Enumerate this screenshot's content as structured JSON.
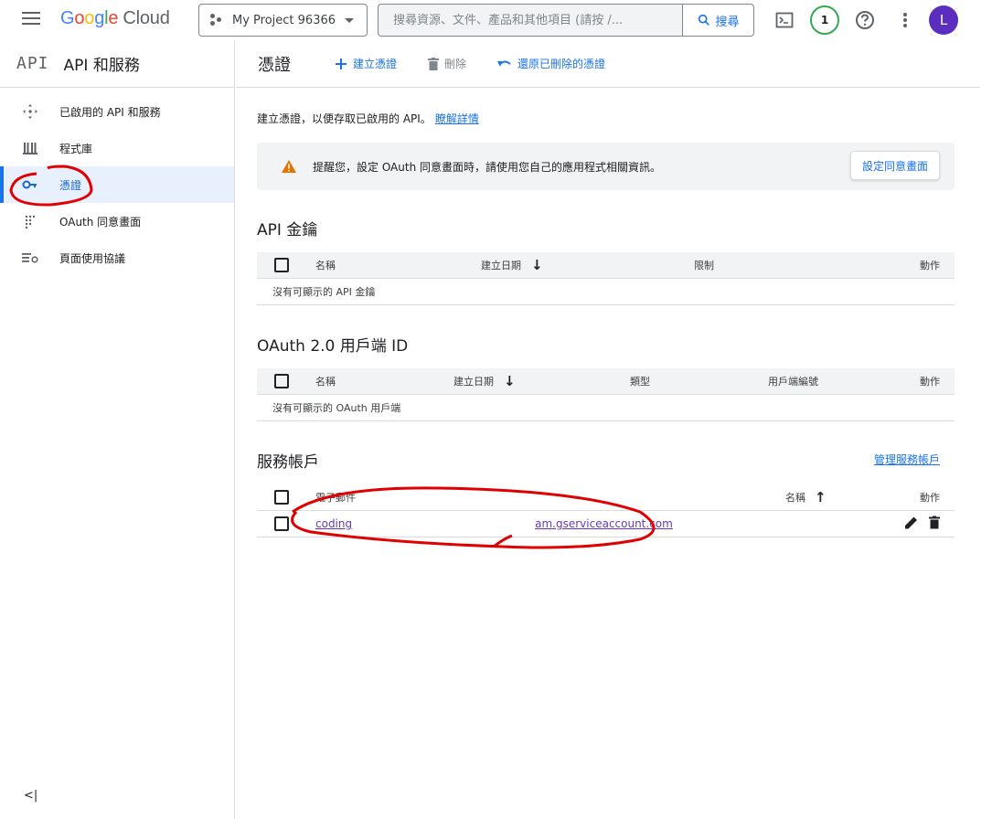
{
  "topbar": {
    "logo": {
      "g": "G",
      "o1": "o",
      "o2": "o",
      "g2": "g",
      "l": "l",
      "e": "e",
      "cloud": "Cloud"
    },
    "project_label": "My Project 96366",
    "search_placeholder": "搜尋資源、文件、產品和其他項目 (請按 /...",
    "search_button": "搜尋",
    "notification_count": "1",
    "avatar_letter": "L"
  },
  "sidebar": {
    "logo_text": "API",
    "title": "API 和服務",
    "items": [
      {
        "label": "已啟用的 API 和服務",
        "icon": "api-diamond-icon"
      },
      {
        "label": "程式庫",
        "icon": "library-icon"
      },
      {
        "label": "憑證",
        "icon": "key-icon",
        "active": true
      },
      {
        "label": "OAuth 同意畫面",
        "icon": "dots-grid-icon"
      },
      {
        "label": "頁面使用協議",
        "icon": "settings-list-icon"
      }
    ],
    "collapse_label": "<|"
  },
  "main": {
    "title": "憑證",
    "actions": {
      "create": "建立憑證",
      "delete": "刪除",
      "restore": "還原已刪除的憑證"
    },
    "intro": "建立憑證，以便存取已啟用的 API。",
    "intro_link": "瞭解詳情",
    "alert": {
      "text": "提醒您，設定 OAuth 同意畫面時，請使用您自己的應用程式相關資訊。",
      "button": "設定同意畫面"
    },
    "api_keys": {
      "title": "API 金鑰",
      "columns": {
        "name": "名稱",
        "created": "建立日期",
        "restrictions": "限制",
        "actions": "動作"
      },
      "empty": "沒有可顯示的 API 金鑰"
    },
    "oauth": {
      "title": "OAuth 2.0 用戶端 ID",
      "columns": {
        "name": "名稱",
        "created": "建立日期",
        "type": "類型",
        "client_id": "用戶端編號",
        "actions": "動作"
      },
      "empty": "沒有可顯示的 OAuth 用戶端"
    },
    "service_accounts": {
      "title": "服務帳戶",
      "manage_link": "管理服務帳戶",
      "columns": {
        "email": "電子郵件",
        "name": "名稱",
        "actions": "動作"
      },
      "rows": [
        {
          "email_start": "coding",
          "email_end": "am.gserviceaccount.com"
        }
      ]
    }
  },
  "colors": {
    "accent": "#1a73e8",
    "warning": "#e37400",
    "annotation": "#e00000",
    "avatar": "#5b2ebf"
  }
}
